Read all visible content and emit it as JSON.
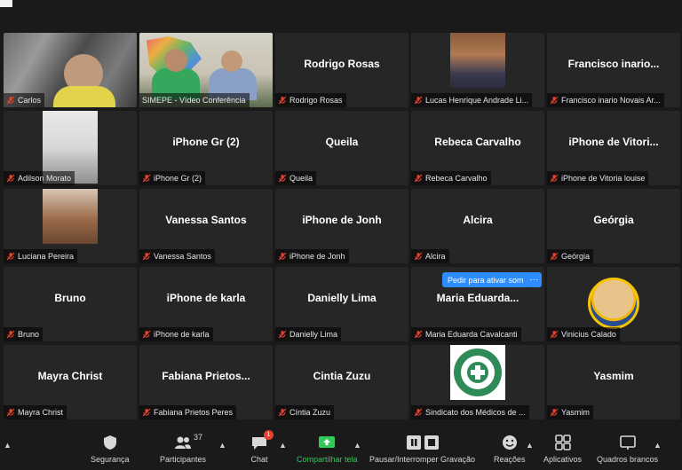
{
  "participants": [
    {
      "name": "Carlos",
      "display": "video"
    },
    {
      "name": "SIMEPE - Vídeo Conferência",
      "display": "video",
      "active": true
    },
    {
      "name": "Rodrigo Rosas",
      "center": "Rodrigo Rosas"
    },
    {
      "name": "Lucas Henrique Andrade Li...",
      "display": "photo"
    },
    {
      "name": "Francisco inario Novais Ar...",
      "center": "Francisco  inario..."
    },
    {
      "name": "Adilson Morato",
      "display": "photo"
    },
    {
      "name": "iPhone Gr (2)",
      "center": "iPhone Gr (2)"
    },
    {
      "name": "Queila",
      "center": "Queila"
    },
    {
      "name": "Rebeca Carvalho",
      "center": "Rebeca Carvalho"
    },
    {
      "name": "iPhone de Vitoria louise",
      "center": "iPhone  de  Vitori..."
    },
    {
      "name": "Luciana Pereira",
      "display": "photo"
    },
    {
      "name": "Vanessa Santos",
      "center": "Vanessa Santos"
    },
    {
      "name": "iPhone de Jonh",
      "center": "iPhone de Jonh"
    },
    {
      "name": "Alcira",
      "center": "Alcira"
    },
    {
      "name": "Geórgia",
      "center": "Geórgia"
    },
    {
      "name": "Bruno",
      "center": "Bruno"
    },
    {
      "name": "iPhone de karla",
      "center": "iPhone de karla"
    },
    {
      "name": "Danielly Lima",
      "center": "Danielly Lima"
    },
    {
      "name": "Maria Eduarda Cavalcanti",
      "center": "Maria  Eduarda..."
    },
    {
      "name": "Vinicius Calado",
      "display": "avatar"
    },
    {
      "name": "Mayra Christ",
      "center": "Mayra Christ"
    },
    {
      "name": "Fabiana Prietos Peres",
      "center": "Fabiana  Prietos..."
    },
    {
      "name": "Cíntia Zuzu",
      "center": "Cintia Zuzu"
    },
    {
      "name": "Sindicato dos Médicos de ...",
      "display": "logo"
    },
    {
      "name": "Yasmim",
      "center": "Yasmim"
    }
  ],
  "unmute_tip": "Pedir para ativar som",
  "unmute_more": "···",
  "toolbar": {
    "security": "Segurança",
    "participants": "Participantes",
    "participants_count": "37",
    "chat": "Chat",
    "chat_badge": "1",
    "share": "Compartilhar tela",
    "record": "Pausar/Interromper Gravação",
    "reactions": "Reações",
    "apps": "Aplicativos",
    "whiteboards": "Quadros brancos"
  },
  "colors": {
    "active_speaker": "#c7dc3c",
    "share_green": "#34c759",
    "accent_blue": "#2d8cff",
    "badge_red": "#e8412f"
  }
}
